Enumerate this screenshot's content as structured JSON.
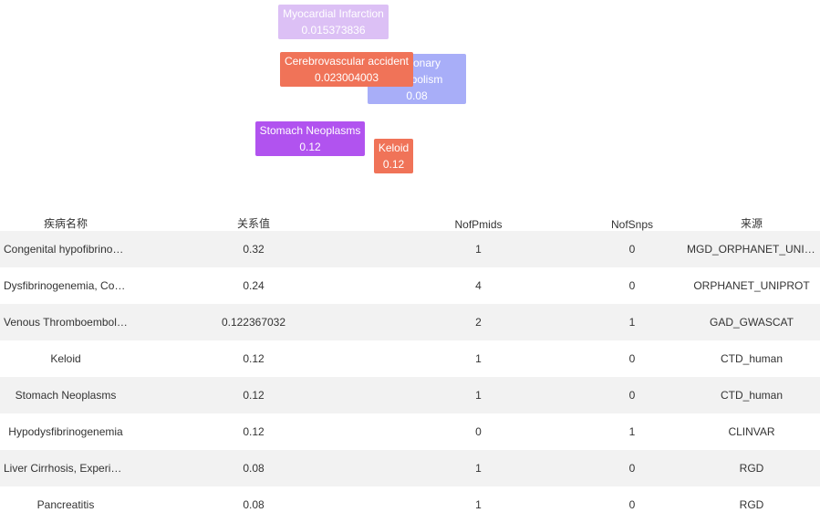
{
  "bubbles": [
    {
      "name": "Myocardial Infarction",
      "value": "0.015373836",
      "color": "#dcc0f5"
    },
    {
      "name_line1": "onary",
      "name_line2": "bolism",
      "value": "0.08",
      "color": "#a8aef8"
    },
    {
      "name": "Cerebrovascular accident",
      "value": "0.023004003",
      "color": "#f07358"
    },
    {
      "name": "Stomach Neoplasms",
      "value": "0.12",
      "color": "#b153ef"
    },
    {
      "name": "Keloid",
      "value": "0.12",
      "color": "#f07358"
    }
  ],
  "table": {
    "headers": [
      "疾病名称",
      "关系值",
      "NofPmids",
      "NofSnps",
      "来源"
    ],
    "rows": [
      [
        "Congenital hypofibrinogenemia",
        "0.32",
        "1",
        "0",
        "MGD_ORPHANET_UNIPROT"
      ],
      [
        "Dysfibrinogenemia, Congenital",
        "0.24",
        "4",
        "0",
        "ORPHANET_UNIPROT"
      ],
      [
        "Venous Thromboembolism",
        "0.122367032",
        "2",
        "1",
        "GAD_GWASCAT"
      ],
      [
        "Keloid",
        "0.12",
        "1",
        "0",
        "CTD_human"
      ],
      [
        "Stomach Neoplasms",
        "0.12",
        "1",
        "0",
        "CTD_human"
      ],
      [
        "Hypodysfibrinogenemia",
        "0.12",
        "0",
        "1",
        "CLINVAR"
      ],
      [
        "Liver Cirrhosis, Experimental",
        "0.08",
        "1",
        "0",
        "RGD"
      ],
      [
        "Pancreatitis",
        "0.08",
        "1",
        "0",
        "RGD"
      ]
    ]
  }
}
